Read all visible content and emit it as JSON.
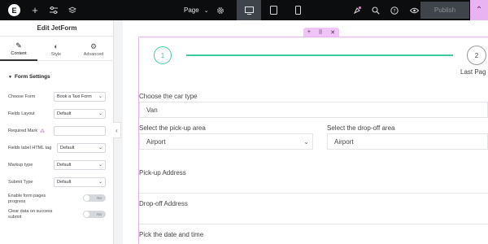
{
  "topbar": {
    "logo_glyph": "E",
    "page_label": "Page",
    "publish_label": "Publish",
    "icons": [
      "plus-icon",
      "sliders-icon",
      "layers-icon",
      "gear-icon",
      "desktop-icon",
      "tablet-icon",
      "mobile-icon",
      "notifications-icon",
      "search-icon",
      "help-icon",
      "eye-icon",
      "chevron-up-icon"
    ]
  },
  "panel": {
    "title": "Edit JetForm",
    "tabs": [
      {
        "label": "Content",
        "icon": "pencil-icon"
      },
      {
        "label": "Style",
        "icon": "half-circle-icon"
      },
      {
        "label": "Advanced",
        "icon": "gear-icon"
      }
    ],
    "section_title": "Form Settings",
    "fields": {
      "choose_form": {
        "label": "Choose Form",
        "value": "Book a Taxi Form"
      },
      "fields_layout": {
        "label": "Fields Layout",
        "value": "Default"
      },
      "required_mark": {
        "label": "Required Mark",
        "value": ""
      },
      "label_tag": {
        "label": "Fields label HTML tag",
        "value": "Default"
      },
      "markup_type": {
        "label": "Markup type",
        "value": "Default"
      },
      "submit_type": {
        "label": "Submit Type",
        "value": "Default"
      }
    },
    "toggles": {
      "progress": {
        "label_line1": "Enable form pages",
        "label_line2": "progress",
        "state": "No"
      },
      "clear_data": {
        "label_line1": "Clear data on success",
        "label_line2": "submit",
        "state": "No"
      }
    }
  },
  "canvas": {
    "steps": {
      "step1": "1",
      "step2": "2",
      "last_page": "Last Pag"
    },
    "car_type": {
      "label": "Choose the car type",
      "value": "Van"
    },
    "pickup_area": {
      "label": "Select the pick-up area",
      "value": "Airport"
    },
    "dropoff_area": {
      "label": "Select the drop-off area",
      "value": "Airport"
    },
    "pickup_address": {
      "label": "Pick-up Address"
    },
    "dropoff_address": {
      "label": "Drop-off Address"
    },
    "datetime": {
      "label": "Pick the date and time"
    }
  },
  "colors": {
    "accent_green": "#3fcca0",
    "section_pink": "#e9b3f2",
    "topbar_bg": "#0c0d0e"
  }
}
